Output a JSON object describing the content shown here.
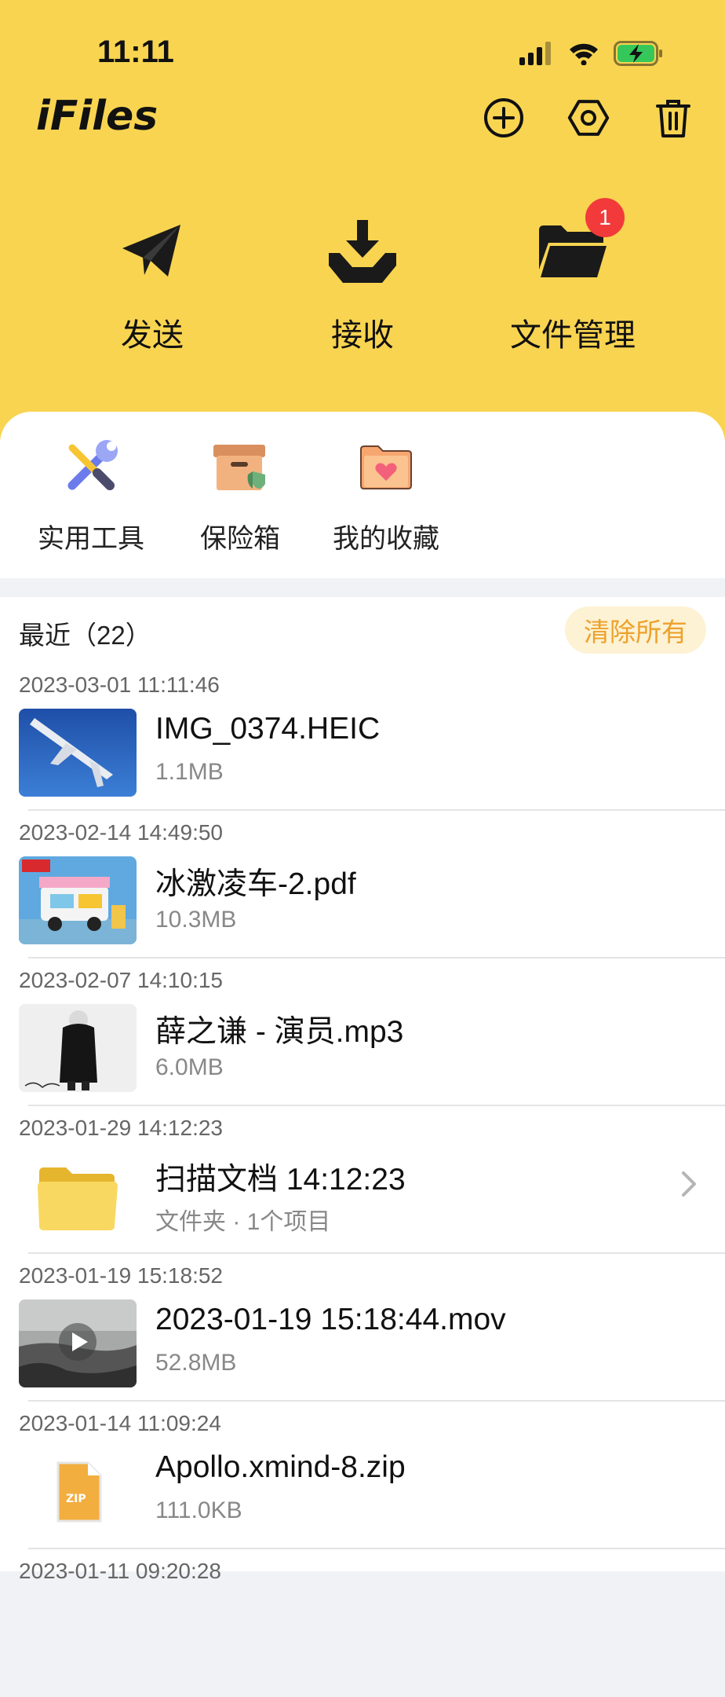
{
  "status": {
    "time": "11:11"
  },
  "app": {
    "title": "iFiles"
  },
  "icons": {
    "add": "plus-circle-icon",
    "settings": "hexagon-gear-icon",
    "delete": "trash-icon",
    "signal": "cellular-signal-icon",
    "wifi": "wifi-icon",
    "battery": "battery-charging-icon"
  },
  "actions": [
    {
      "label": "发送",
      "icon": "paper-plane-icon"
    },
    {
      "label": "接收",
      "icon": "download-tray-icon"
    },
    {
      "label": "文件管理",
      "icon": "folder-icon",
      "badge": "1"
    }
  ],
  "tools": [
    {
      "label": "实用工具",
      "icon": "wrench-screwdriver-icon"
    },
    {
      "label": "保险箱",
      "icon": "safe-box-icon"
    },
    {
      "label": "我的收藏",
      "icon": "heart-folder-icon"
    }
  ],
  "recent": {
    "title": "最近（22）",
    "clear_label": "清除所有",
    "items": [
      {
        "time": "2023-03-01 11:11:46",
        "name": "IMG_0374.HEIC",
        "meta": "1.1MB",
        "type": "image"
      },
      {
        "time": "2023-02-14 14:49:50",
        "name": "冰激凌车-2.pdf",
        "meta": "10.3MB",
        "type": "pdf"
      },
      {
        "time": "2023-02-07 14:10:15",
        "name": "薛之谦 - 演员.mp3",
        "meta": "6.0MB",
        "type": "audio"
      },
      {
        "time": "2023-01-29 14:12:23",
        "name": "扫描文档 14:12:23",
        "meta": "文件夹 · 1个项目",
        "type": "folder"
      },
      {
        "time": "2023-01-19 15:18:52",
        "name": "2023-01-19 15:18:44.mov",
        "meta": "52.8MB",
        "type": "video"
      },
      {
        "time": "2023-01-14 11:09:24",
        "name": "Apollo.xmind-8.zip",
        "meta": "111.0KB",
        "type": "zip"
      },
      {
        "time": "2023-01-11 09:20:28"
      }
    ]
  },
  "colors": {
    "header": "#F8D451",
    "badge": "#F23A3A",
    "clear_text": "#EDA12B",
    "clear_bg": "#FDF2D3"
  }
}
